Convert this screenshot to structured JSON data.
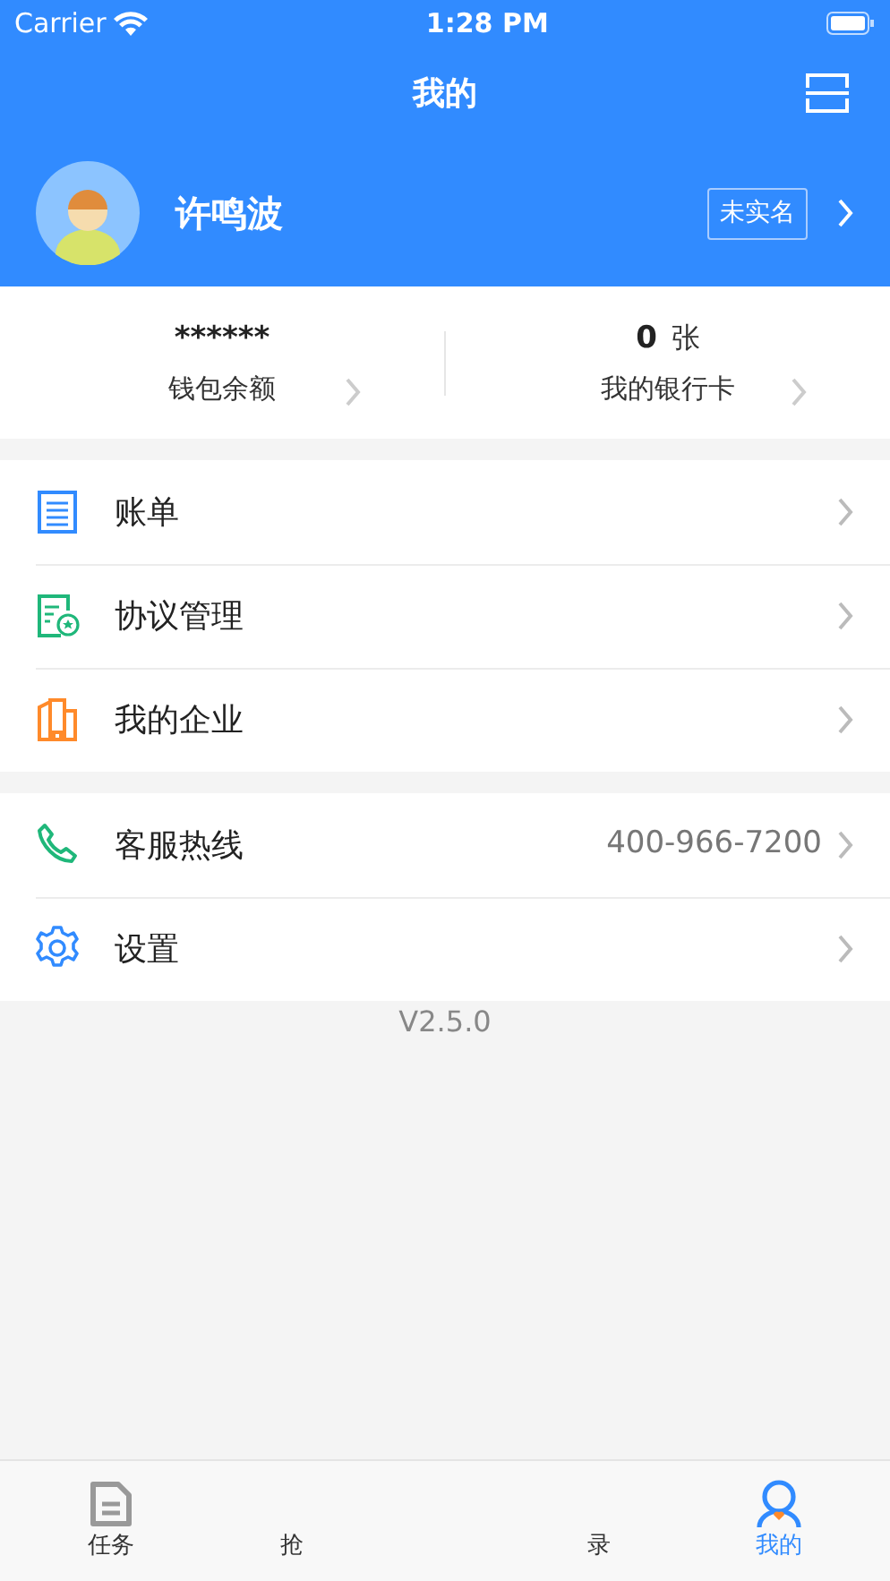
{
  "status_bar": {
    "carrier": "Carrier",
    "time": "1:28 PM"
  },
  "nav": {
    "title": "我的"
  },
  "profile": {
    "name": "许鸣波",
    "badge": "未实名"
  },
  "stats": [
    {
      "value": "******",
      "label": "钱包余额"
    },
    {
      "value": "0",
      "unit": "张",
      "label": "我的银行卡"
    }
  ],
  "menu_groups": [
    [
      {
        "kind": "bill",
        "label": "账单"
      },
      {
        "kind": "agreement",
        "label": "协议管理"
      },
      {
        "kind": "company",
        "label": "我的企业"
      }
    ],
    [
      {
        "kind": "phone",
        "label": "客服热线",
        "value": "400-966-7200"
      },
      {
        "kind": "settings",
        "label": "设置"
      }
    ]
  ],
  "version": "V2.5.0",
  "tabs": [
    {
      "kind": "task",
      "label": "任务",
      "selected": false
    },
    {
      "kind": "hidden",
      "label": "抢",
      "selected": false
    },
    {
      "kind": "hidden",
      "label": "录",
      "selected": false
    },
    {
      "kind": "me",
      "label": "我的",
      "selected": true
    }
  ]
}
